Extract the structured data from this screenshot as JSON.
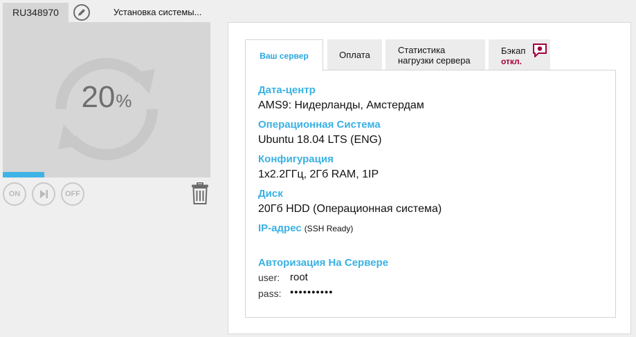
{
  "server": {
    "id": "RU348970",
    "status_text": "Установка системы...",
    "progress": {
      "value": "20",
      "unit": "%",
      "fraction": 0.2
    },
    "controls": {
      "on": "ON",
      "off": "OFF"
    }
  },
  "tabs": [
    {
      "label": "Ваш сервер",
      "active": true
    },
    {
      "label": "Оплата"
    },
    {
      "label_line1": "Статистика",
      "label_line2": "нагрузки сервера"
    },
    {
      "label": "Бэкап",
      "status": "откл."
    }
  ],
  "details": {
    "datacenter_label": "Дата-центр",
    "datacenter_value": "AMS9: Нидерланды, Амстердам",
    "os_label": "Операционная Система",
    "os_value": "Ubuntu 18.04 LTS (ENG)",
    "config_label": "Конфигурация",
    "config_value": "1x2.2ГГц, 2Гб RAM, 1IP",
    "disk_label": "Диск",
    "disk_value": "20Гб HDD (Операционная система)",
    "ip_label": "IP-адрес",
    "ip_note": "(SSH Ready)",
    "auth_label": "Авторизация На Сервере",
    "user_key": "user:",
    "user_value": "root",
    "pass_key": "pass:",
    "pass_value": "••••••••••"
  },
  "colors": {
    "accent": "#39b1e3",
    "progress_fill": "#3fb3e6",
    "backup_off": "#a0003c",
    "panel_gray": "#d6d6d6"
  },
  "icons": [
    "pencil-icon",
    "refresh-ring-icon",
    "power-on-icon",
    "play-pause-icon",
    "power-off-icon",
    "trash-icon",
    "chat-bubble-icon"
  ]
}
